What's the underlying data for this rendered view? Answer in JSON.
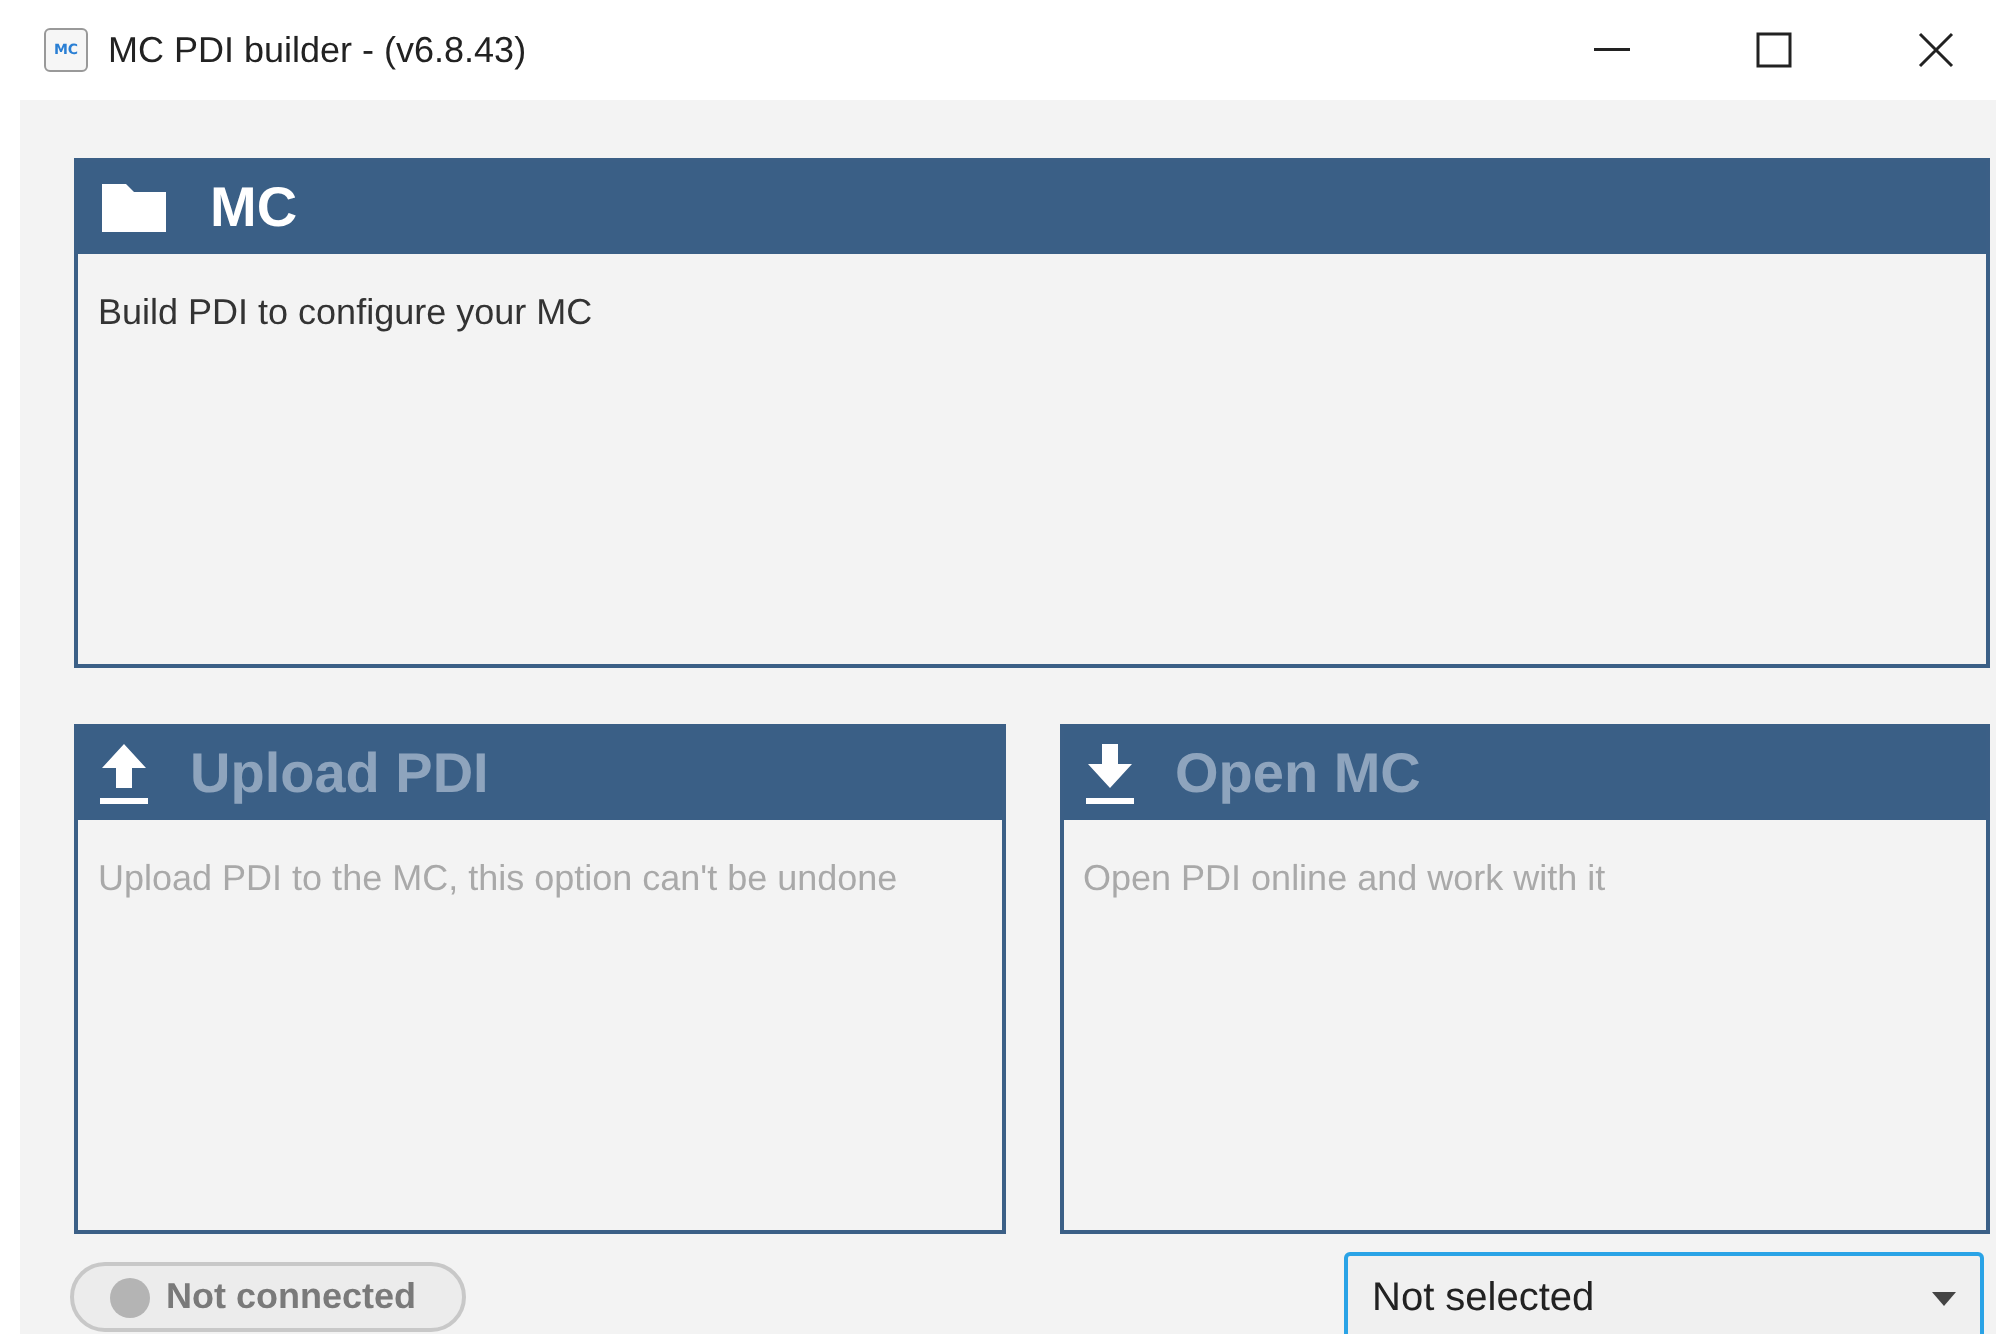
{
  "window": {
    "title": "MC PDI builder - (v6.8.43)",
    "app_icon_text": "MC"
  },
  "main_card": {
    "title": "MC",
    "description": "Build PDI to configure your MC",
    "disabled": false,
    "kind": "folder"
  },
  "cards": [
    {
      "title": "Upload PDI",
      "description": "Upload PDI to the MC, this option can't be undone",
      "disabled": true,
      "kind": "upload"
    },
    {
      "title": "Open MC",
      "description": "Open PDI online and work with it",
      "disabled": true,
      "kind": "download"
    }
  ],
  "status": {
    "label": "Not connected",
    "connected": false
  },
  "device_select": {
    "value": "Not selected",
    "focused": true
  }
}
